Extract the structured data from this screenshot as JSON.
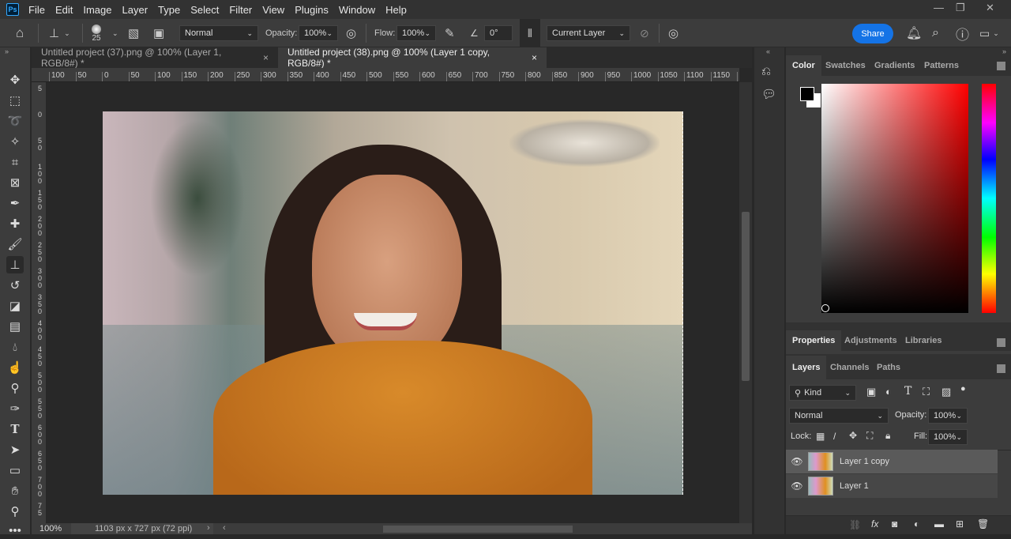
{
  "menubar": {
    "logo": "Ps",
    "items": [
      "File",
      "Edit",
      "Image",
      "Layer",
      "Type",
      "Select",
      "Filter",
      "View",
      "Plugins",
      "Window",
      "Help"
    ]
  },
  "options": {
    "brush_size": "25",
    "mode": "Normal",
    "opacity_label": "Opacity:",
    "opacity": "100%",
    "flow_label": "Flow:",
    "flow": "100%",
    "angle": "0°",
    "sample": "Current Layer",
    "share": "Share"
  },
  "tabs": [
    {
      "label": "Untitled project (37).png @ 100% (Layer 1, RGB/8#) *",
      "close": "×"
    },
    {
      "label": "Untitled project (38).png @ 100% (Layer 1 copy, RGB/8#) *",
      "close": "×"
    }
  ],
  "hruler": [
    "100",
    "50",
    "0",
    "50",
    "100",
    "150",
    "200",
    "250",
    "300",
    "350",
    "400",
    "450",
    "500",
    "550",
    "600",
    "650",
    "700",
    "750",
    "800",
    "850",
    "900",
    "950",
    "1000",
    "1050",
    "1100",
    "1150",
    "1"
  ],
  "vruler": [
    "5",
    "0",
    "50",
    "100",
    "150",
    "200",
    "250",
    "300",
    "350",
    "400",
    "450",
    "500",
    "550",
    "600",
    "650",
    "700",
    "75"
  ],
  "status": {
    "zoom": "100%",
    "doc": "1103 px x 727 px (72 ppi)"
  },
  "color_panel": {
    "tabs": [
      "Color",
      "Swatches",
      "Gradients",
      "Patterns"
    ],
    "hue_color": "#ff0000"
  },
  "props_panel": {
    "tabs": [
      "Properties",
      "Adjustments",
      "Libraries"
    ]
  },
  "layers_panel": {
    "tabs": [
      "Layers",
      "Channels",
      "Paths"
    ],
    "filter": "Kind",
    "blend": "Normal",
    "opacity_label": "Opacity:",
    "opacity": "100%",
    "lock_label": "Lock:",
    "fill_label": "Fill:",
    "fill": "100%",
    "layers": [
      {
        "name": "Layer 1 copy",
        "selected": true
      },
      {
        "name": "Layer 1",
        "selected": false
      }
    ]
  }
}
